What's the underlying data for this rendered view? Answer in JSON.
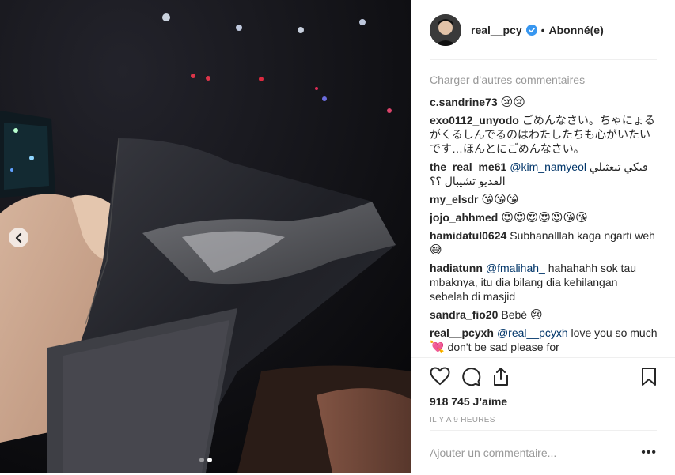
{
  "post": {
    "username": "real__pcy",
    "separator": "•",
    "follow_label": "Abonné(e)",
    "load_more_label": "Charger d’autres commentaires",
    "likes_text": "918 745 J’aime",
    "timestamp": "IL Y A 9 HEURES",
    "add_comment_placeholder": "Ajouter un commentaire...",
    "more_options": "•••",
    "carousel": {
      "slides": 2,
      "active": 2
    }
  },
  "comments": [
    {
      "user": "c.sandrine73",
      "parts": [
        {
          "t": "😢😢",
          "e": true
        }
      ]
    },
    {
      "user": "exo0112_unyodo",
      "parts": [
        {
          "t": "ごめんなさい。ちゃにょるがくるしんでるのはわたしたちも心がいたいです…ほんとにごめんなさい。"
        }
      ]
    },
    {
      "user": "the_real_me61",
      "parts": [
        {
          "t": "@kim_namyeol",
          "m": true
        },
        {
          "t": " فيكي تبعثيلي الفديو تشيبال ؟؟"
        }
      ]
    },
    {
      "user": "my_elsdr",
      "parts": [
        {
          "t": "😘😘😘",
          "e": true
        }
      ]
    },
    {
      "user": "jojo_ahhmed",
      "parts": [
        {
          "t": "😍😍😍😍😍😘😘",
          "e": true
        }
      ]
    },
    {
      "user": "hamidatul0624",
      "parts": [
        {
          "t": "Subhanalllah kaga ngarti weh"
        },
        {
          "t": "😅",
          "e": true
        }
      ]
    },
    {
      "user": "hadiatunn",
      "parts": [
        {
          "t": "@fmalihah_",
          "m": true
        },
        {
          "t": " hahahahh sok tau mbaknya, itu dia bilang dia kehilangan sebelah di masjid"
        }
      ]
    },
    {
      "user": "sandra_fio20",
      "parts": [
        {
          "t": "Bebé "
        },
        {
          "t": "😢",
          "e": true
        }
      ]
    },
    {
      "user": "real__pcyxh",
      "parts": [
        {
          "t": "@real__pcyxh",
          "m": true
        },
        {
          "t": " love you so much "
        },
        {
          "t": "💘",
          "e": true
        },
        {
          "t": " don't be sad please for"
        }
      ]
    }
  ],
  "icons": {
    "prev": "chevron-left-icon",
    "verified": "verified-badge-icon",
    "like": "heart-icon",
    "comment": "comment-bubble-icon",
    "share": "share-icon",
    "save": "bookmark-icon"
  },
  "colors": {
    "verified": "#3897f0",
    "mention": "#003569",
    "muted": "#999999"
  }
}
